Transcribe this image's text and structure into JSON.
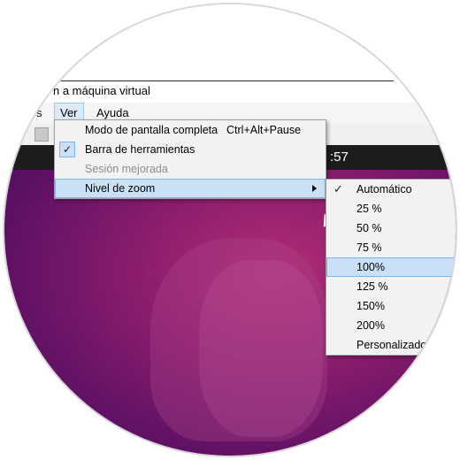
{
  "window": {
    "title_partial": "n a máquina virtual"
  },
  "menubar": {
    "items": [
      "s",
      "Ver",
      "Ayuda"
    ]
  },
  "panel": {
    "clock_partial": ":57"
  },
  "ver_menu": {
    "items": [
      {
        "label": "Modo de pantalla completa",
        "shortcut": "Ctrl+Alt+Pause",
        "checked": false,
        "enabled": true
      },
      {
        "label": "Barra de herramientas",
        "shortcut": "",
        "checked": true,
        "enabled": true
      },
      {
        "label": "Sesión mejorada",
        "shortcut": "",
        "checked": false,
        "enabled": false
      },
      {
        "label": "Nivel de zoom",
        "shortcut": "",
        "checked": false,
        "enabled": true,
        "submenu": true,
        "highlighted": true
      }
    ]
  },
  "zoom_menu": {
    "items": [
      {
        "label": "Automático",
        "checked": true
      },
      {
        "label": "25 %",
        "checked": false
      },
      {
        "label": "50 %",
        "checked": false
      },
      {
        "label": "75 %",
        "checked": false
      },
      {
        "label": "100%",
        "checked": false,
        "highlighted": true
      },
      {
        "label": "125 %",
        "checked": false
      },
      {
        "label": "150%",
        "checked": false
      },
      {
        "label": "200%",
        "checked": false
      },
      {
        "label": "Personalizado",
        "checked": false
      }
    ]
  },
  "icons": {
    "check": "check-icon",
    "submenu_arrow": "chevron-right-icon",
    "cursor": "mouse-cursor-icon"
  },
  "colors": {
    "highlight": "#c9e0f7",
    "highlight_border": "#7fb4e6",
    "panel": "#1c1c1c",
    "desktop": "#8c1d6e"
  }
}
